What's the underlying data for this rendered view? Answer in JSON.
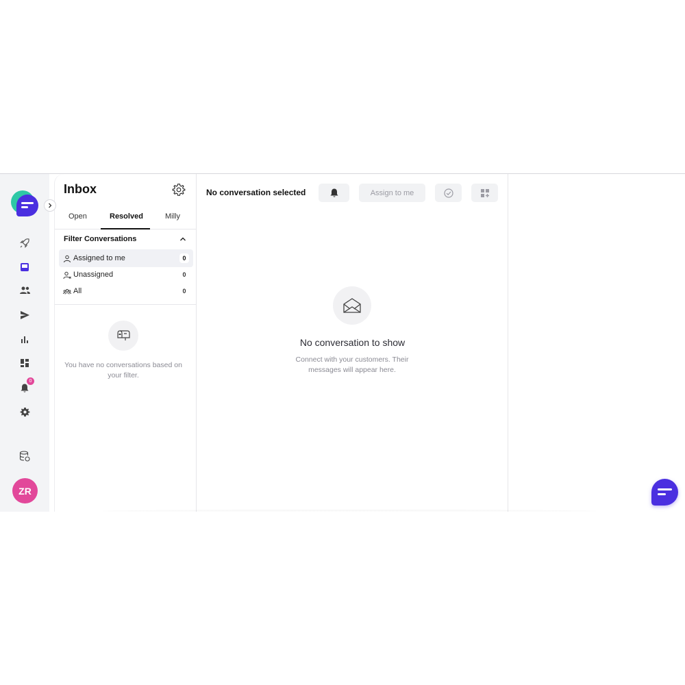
{
  "inbox": {
    "title": "Inbox",
    "tabs": [
      {
        "label": "Open",
        "active": false
      },
      {
        "label": "Resolved",
        "active": true
      },
      {
        "label": "Milly",
        "active": false
      }
    ],
    "filter": {
      "heading": "Filter Conversations",
      "items": [
        {
          "label": "Assigned to me",
          "count": "0",
          "icon": "user-icon",
          "active": true
        },
        {
          "label": "Unassigned",
          "count": "0",
          "icon": "user-question-icon",
          "active": false
        },
        {
          "label": "All",
          "count": "0",
          "icon": "users-icon",
          "active": false
        }
      ]
    },
    "empty_text": "You have no conversations based on your filter."
  },
  "conversation": {
    "title": "No conversation selected",
    "assign_label": "Assign to me",
    "empty_title": "No conversation to show",
    "empty_subtitle": "Connect with your customers. Their messages will appear here."
  },
  "rail": {
    "items": [
      "rocket-icon",
      "inbox-icon",
      "contacts-icon",
      "send-icon",
      "reports-icon",
      "dashboard-icon",
      "notifications-icon",
      "settings-icon",
      "database-icon"
    ],
    "notification_count": "0",
    "avatar_initials": "ZR"
  },
  "colors": {
    "brand": "#4a2fe0",
    "brand_secondary": "#2fc8a6",
    "avatar": "#e2489a",
    "rail_bg": "#f3f4f6"
  }
}
